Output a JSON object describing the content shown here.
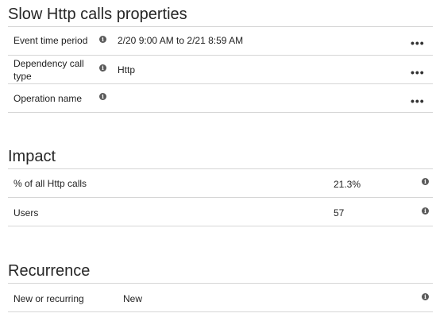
{
  "properties": {
    "title": "Slow Http calls properties",
    "rows": [
      {
        "label": "Event time period",
        "value": "2/20 9:00 AM to 2/21 8:59 AM"
      },
      {
        "label": "Dependency call type",
        "value": "Http"
      },
      {
        "label": "Operation name",
        "value": ""
      }
    ]
  },
  "impact": {
    "title": "Impact",
    "rows": [
      {
        "label": "% of all Http calls",
        "value": "21.3%"
      },
      {
        "label": "Users",
        "value": "57"
      }
    ]
  },
  "recurrence": {
    "title": "Recurrence",
    "rows": [
      {
        "label": "New or recurring",
        "value": "New"
      }
    ]
  },
  "icons": {
    "info": "info-icon",
    "more": "more-options-icon"
  }
}
